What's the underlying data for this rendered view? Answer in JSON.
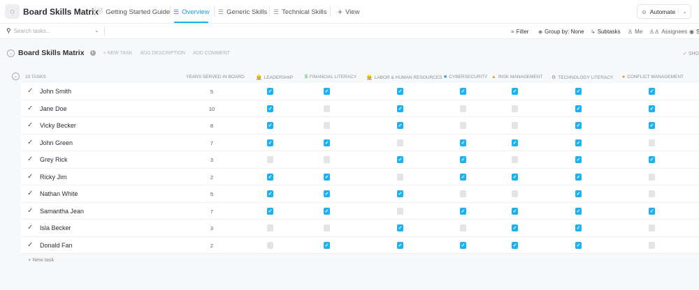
{
  "header": {
    "title": "Board Skills Matrix",
    "tabs": [
      {
        "label": "Getting Started Guide",
        "icon": "doc-icon",
        "active": false
      },
      {
        "label": "Overview",
        "icon": "list-icon",
        "active": true
      },
      {
        "label": "Generic Skills",
        "icon": "list-icon",
        "active": false
      },
      {
        "label": "Technical Skills",
        "icon": "list-icon",
        "active": false
      }
    ],
    "add_view": "View",
    "automate": "Automate"
  },
  "toolbar": {
    "search_placeholder": "Search tasks...",
    "filter": "Filter",
    "group_by": "Group by: None",
    "subtasks": "Subtasks",
    "me": "Me",
    "assignees": "Assignees",
    "show_partial": "S"
  },
  "group": {
    "title": "Board Skills Matrix",
    "new_task": "+ NEW TASK",
    "add_description": "ADD DESCRIPTION",
    "add_comment": "ADD COMMENT",
    "show": "SHO",
    "task_count": "10 TASKS",
    "new_task_footer": "+ New task"
  },
  "columns": {
    "years": "YEARS SERVED IN BOARD",
    "skills": [
      {
        "label": "LEADERSHIP",
        "icon": "👷",
        "color": "#c98a1b"
      },
      {
        "label": "FINANCIAL LITERACY",
        "icon": "$",
        "color": "#2ebd59"
      },
      {
        "label": "LABOR & HUMAN RESOURCES",
        "icon": "👷",
        "color": "#d9a520"
      },
      {
        "label": "CYBERSECURITY",
        "icon": "■",
        "color": "#3aa0e6"
      },
      {
        "label": "RISK MANAGEMENT",
        "icon": "▲",
        "color": "#f0a020"
      },
      {
        "label": "TECHNOLOGY LITERACY",
        "icon": "⚙",
        "color": "#888888"
      },
      {
        "label": "CONFLICT MANAGEMENT",
        "icon": "●",
        "color": "#f08a20"
      }
    ]
  },
  "rows": [
    {
      "name": "John Smith",
      "years": "5",
      "skills": [
        1,
        1,
        1,
        1,
        1,
        1,
        1
      ]
    },
    {
      "name": "Jane Doe",
      "years": "10",
      "skills": [
        1,
        0,
        1,
        0,
        0,
        1,
        1
      ]
    },
    {
      "name": "Vicky Becker",
      "years": "8",
      "skills": [
        1,
        0,
        1,
        0,
        0,
        1,
        1
      ]
    },
    {
      "name": "John Green",
      "years": "7",
      "skills": [
        1,
        1,
        0,
        1,
        1,
        1,
        0
      ]
    },
    {
      "name": "Grey Rick",
      "years": "3",
      "skills": [
        0,
        0,
        1,
        1,
        0,
        1,
        1
      ]
    },
    {
      "name": "Ricky Jim",
      "years": "2",
      "skills": [
        1,
        1,
        0,
        1,
        1,
        1,
        0
      ]
    },
    {
      "name": "Nathan White",
      "years": "5",
      "skills": [
        1,
        1,
        1,
        0,
        0,
        1,
        0
      ]
    },
    {
      "name": "Samantha Jean",
      "years": "7",
      "skills": [
        1,
        1,
        0,
        1,
        1,
        1,
        1
      ]
    },
    {
      "name": "Isla Becker",
      "years": "3",
      "skills": [
        0,
        0,
        1,
        0,
        1,
        1,
        0
      ]
    },
    {
      "name": "Donald Fan",
      "years": "2",
      "skills": [
        0,
        1,
        1,
        1,
        1,
        1,
        0
      ]
    }
  ]
}
